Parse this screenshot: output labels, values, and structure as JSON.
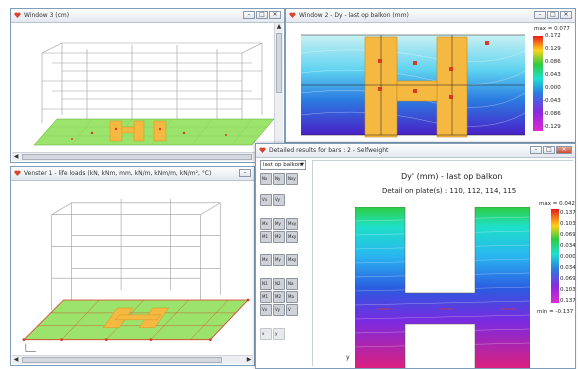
{
  "colors": {
    "plate": "#f5b942",
    "grid": "#9a9a9a",
    "frame_red": "#d93a28",
    "slab_green": "#9be36b"
  },
  "window3": {
    "title": "Window 3  (cm)"
  },
  "window2": {
    "title": "Window 2 - Dy - last op balkon  (mm)",
    "legend_max": "max = 0.077",
    "legend_ticks": [
      "0.172",
      "0.129",
      "0.086",
      "0.043",
      "0.000",
      "-0.043",
      "-0.086",
      "-0.129"
    ]
  },
  "venster1": {
    "title": "Venster 1 - life loads  (kN, kNm, mm, kN/m, kNm/m, kN/m², °C)"
  },
  "detail": {
    "title": "Detailed results for bars : 2 - Selfweight",
    "dropdown": "last op balkon",
    "heading": "Dy' (mm) - last op balkon",
    "subheading": "Detail on plate(s) : 110, 112, 114, 115",
    "legend_max": "max = 0.042",
    "legend_min": "min = -0.137",
    "legend_ticks": [
      "0.137",
      "0.103",
      "0.069",
      "0.034",
      "0.000",
      "0.034",
      "0.069",
      "0.103",
      "0.137"
    ],
    "axis_label": "y"
  },
  "toolbar": [
    [
      "Nx",
      "Ny",
      "Nxy"
    ],
    [
      "Vx",
      "Vy"
    ],
    [
      "Mx",
      "My",
      "Mxy",
      "M1",
      "M2",
      "Mxy"
    ],
    [
      "Mx",
      "My",
      "Mxy"
    ],
    [
      "N1",
      "N2",
      "Na",
      "M1",
      "M2",
      "Ma",
      "Vx",
      "Vy",
      "V"
    ],
    [
      "x",
      "y"
    ]
  ],
  "icons": [
    "app-icon",
    "minimize-icon",
    "maximize-icon",
    "close-icon",
    "scroll-left-icon",
    "scroll-right-icon",
    "scroll-up-icon",
    "scroll-down-icon",
    "dropdown-arrow-icon"
  ]
}
